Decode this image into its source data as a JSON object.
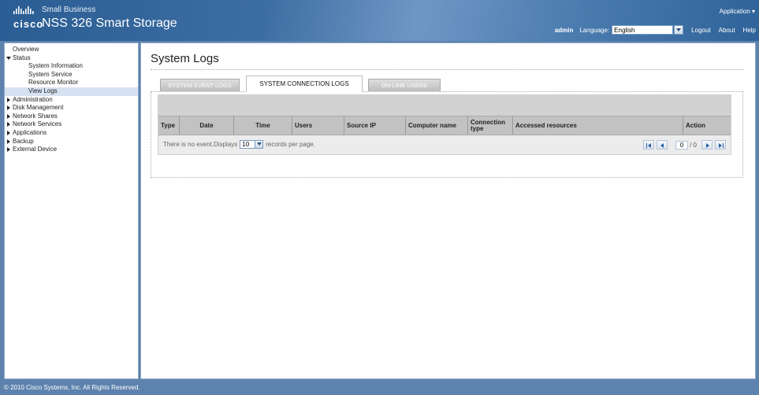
{
  "header": {
    "logo_text": "cisco",
    "brand_top": "Small Business",
    "product_title": "NSS 326 Smart Storage",
    "application_menu": "Application ▾",
    "user": "admin",
    "language_label": "Language:",
    "language_value": "English",
    "logout": "Logout",
    "about": "About",
    "help": "Help"
  },
  "sidebar": {
    "items": [
      {
        "label": "Overview"
      },
      {
        "label": "Status"
      },
      {
        "label": "System Information"
      },
      {
        "label": "System Service"
      },
      {
        "label": "Resource Monitor"
      },
      {
        "label": "View Logs"
      },
      {
        "label": "Administration"
      },
      {
        "label": "Disk Management"
      },
      {
        "label": "Network Shares"
      },
      {
        "label": "Network Services"
      },
      {
        "label": "Applications"
      },
      {
        "label": "Backup"
      },
      {
        "label": "External Device"
      }
    ]
  },
  "main": {
    "title": "System Logs",
    "tabs": [
      {
        "label": "SYSTEM EVENT LOGS"
      },
      {
        "label": "SYSTEM CONNECTION LOGS"
      },
      {
        "label": "ON-LINE USERS"
      }
    ],
    "columns": [
      "Type",
      "Date",
      "Time",
      "Users",
      "Source IP",
      "Computer name",
      "Connection type",
      "Accessed resources",
      "Action"
    ],
    "no_event_text": "There is no event.Displays",
    "records_per_page": "10",
    "records_per_page_suffix": "records per page.",
    "pager": {
      "current": "0",
      "total": "/ 0"
    }
  },
  "footer": {
    "copyright": "© 2010 Cisco Systems, Inc. All Rights Reserved."
  }
}
